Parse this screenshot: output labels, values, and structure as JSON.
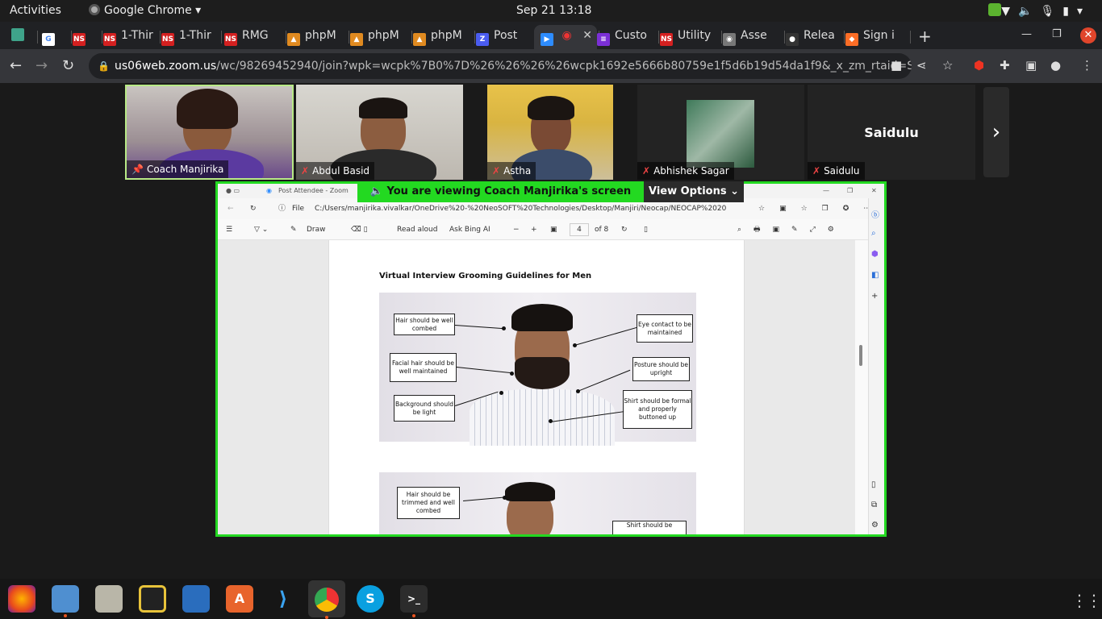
{
  "topbar": {
    "activities": "Activities",
    "app": "Google Chrome ▾",
    "clock": "Sep 21  13:18"
  },
  "tabs": [
    {
      "label": "",
      "fav": "#3fa38a",
      "ftxt": ""
    },
    {
      "label": "",
      "fav": "#fff",
      "ftxt": "G"
    },
    {
      "label": "",
      "fav": "#d42020",
      "ftxt": "NS"
    },
    {
      "label": "1-Thir",
      "fav": "#d42020",
      "ftxt": "NS"
    },
    {
      "label": "1-Thir",
      "fav": "#d42020",
      "ftxt": "NS"
    },
    {
      "label": "RMG",
      "fav": "#d42020",
      "ftxt": "NS"
    },
    {
      "label": "phpM",
      "fav": "#e08a20",
      "ftxt": "▲"
    },
    {
      "label": "phpM",
      "fav": "#e08a20",
      "ftxt": "▲"
    },
    {
      "label": "phpM",
      "fav": "#e08a20",
      "ftxt": "▲"
    },
    {
      "label": "Post",
      "fav": "#4a5cf0",
      "ftxt": "Z"
    },
    {
      "label": "",
      "fav": "#2d8cff",
      "ftxt": "▶"
    },
    {
      "label": "Custo",
      "fav": "#7b2fd6",
      "ftxt": "≡"
    },
    {
      "label": "Utility",
      "fav": "#d42020",
      "ftxt": "NS"
    },
    {
      "label": "Asse",
      "fav": "#777",
      "ftxt": "◉"
    },
    {
      "label": "Relea",
      "fav": "#333",
      "ftxt": "●"
    },
    {
      "label": "Sign i",
      "fav": "#fc6d26",
      "ftxt": "◆"
    }
  ],
  "address": {
    "host": "us06web.zoom.us",
    "path": "/wc/98269452940/join?wpk=wcpk%7B0%7D%26%26%26%26wcpk1692e5666b80759e1f5d6b19d54da1f9&_x_zm_rtaid=S2FMHr..."
  },
  "participants": [
    {
      "name": "Coach Manjirika",
      "pinned": true,
      "muted": false
    },
    {
      "name": "Abdul Basid",
      "pinned": false,
      "muted": true
    },
    {
      "name": "Astha",
      "pinned": false,
      "muted": true
    },
    {
      "name": "Abhishek Sagar",
      "pinned": false,
      "muted": true
    },
    {
      "name": "Saidulu",
      "pinned": false,
      "muted": true,
      "big": "Saidulu"
    }
  ],
  "share": {
    "banner": "You are viewing  Coach Manjirika's screen",
    "view_options": "View Options",
    "window_title": "Post Attendee - Zoom",
    "file_label": "File",
    "file_path": "C:/Users/manjirika.vivalkar/OneDrive%20-%20NeoSOFT%20Technologies/Desktop/Manjiri/Neocap/NEOCAP%202023/Apper...",
    "toolbar": {
      "draw": "Draw",
      "read": "Read aloud",
      "ask": "Ask Bing AI",
      "page": "4",
      "of": "of 8"
    },
    "page_heading": "Virtual Interview Grooming Guidelines for Men",
    "labels1": [
      "Hair should be well combed",
      "Facial hair should be well maintained",
      "Background should be light",
      "Eye contact to be maintained",
      "Posture should be upright",
      "Shirt should be formal and properly buttoned up"
    ],
    "labels2": [
      "Hair should be trimmed and well combed",
      "Shirt should be"
    ]
  }
}
